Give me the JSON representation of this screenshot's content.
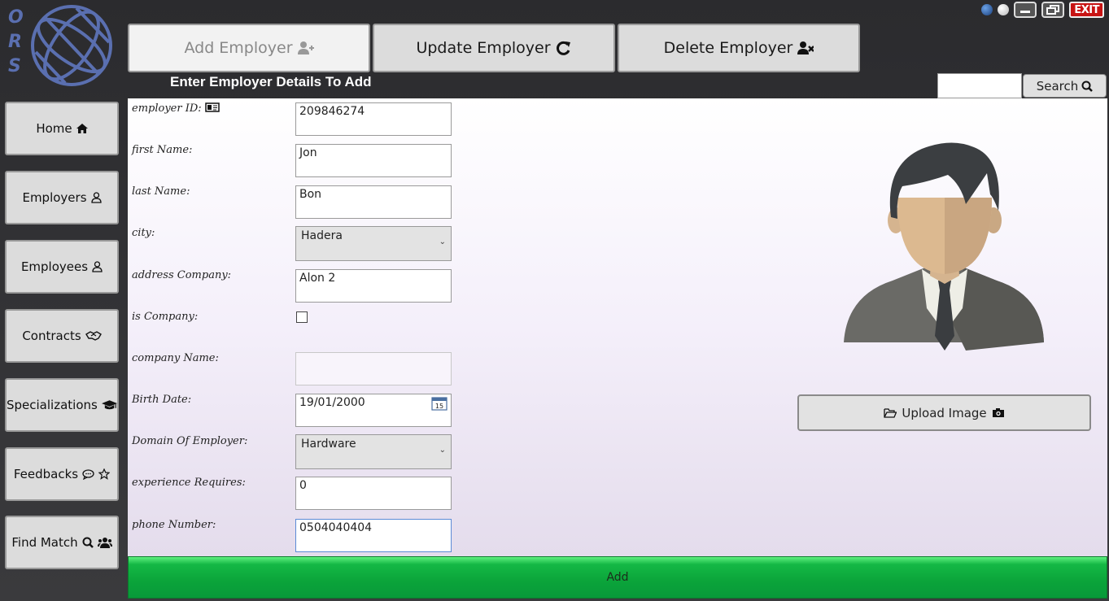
{
  "logo": {
    "letters": [
      "O",
      "R",
      "S"
    ],
    "icon": "globe-icon"
  },
  "window": {
    "exit_label": "EXIT"
  },
  "tabs": [
    {
      "label": "Add Employer",
      "icon": "user-plus-icon",
      "active": true
    },
    {
      "label": "Update Employer",
      "icon": "refresh-icon",
      "active": false
    },
    {
      "label": "Delete Employer",
      "icon": "user-times-icon",
      "active": false
    }
  ],
  "form_title": "Enter Employer Details To Add",
  "search": {
    "label": "Search",
    "value": ""
  },
  "sidebar": {
    "items": [
      {
        "label": "Home",
        "icon": "home-icon"
      },
      {
        "label": "Employers",
        "icon": "user-icon"
      },
      {
        "label": "Employees",
        "icon": "user-icon"
      },
      {
        "label": "Contracts",
        "icon": "handshake-icon"
      },
      {
        "label": "Specializations",
        "icon": "graduation-cap-icon"
      },
      {
        "label": "Feedbacks",
        "icon": "comment-star-icon"
      },
      {
        "label": "Find Match",
        "icon": "search-users-icon"
      }
    ]
  },
  "form": {
    "employer_id": {
      "label": "employer ID:",
      "value": "209846274"
    },
    "first_name": {
      "label": "first Name:",
      "value": "Jon"
    },
    "last_name": {
      "label": "last Name:",
      "value": "Bon"
    },
    "city": {
      "label": "city:",
      "value": "Hadera"
    },
    "address_company": {
      "label": "address Company:",
      "value": "Alon 2"
    },
    "is_company": {
      "label": "is Company:",
      "checked": false
    },
    "company_name": {
      "label": "company Name:",
      "value": ""
    },
    "birth_date": {
      "label": "Birth Date:",
      "value": "19/01/2000",
      "calendar_day": "15"
    },
    "domain": {
      "label": "Domain Of Employer:",
      "value": "Hardware"
    },
    "experience": {
      "label": "experience Requires:",
      "value": "0"
    },
    "phone": {
      "label": "phone Number:",
      "value": "0504040404"
    }
  },
  "upload": {
    "label": "Upload Image"
  },
  "add_button": {
    "label": "Add"
  },
  "colors": {
    "accent_green": "#0ba43a",
    "logo_blue": "#5a6fb0",
    "exit_red": "#c81414"
  }
}
